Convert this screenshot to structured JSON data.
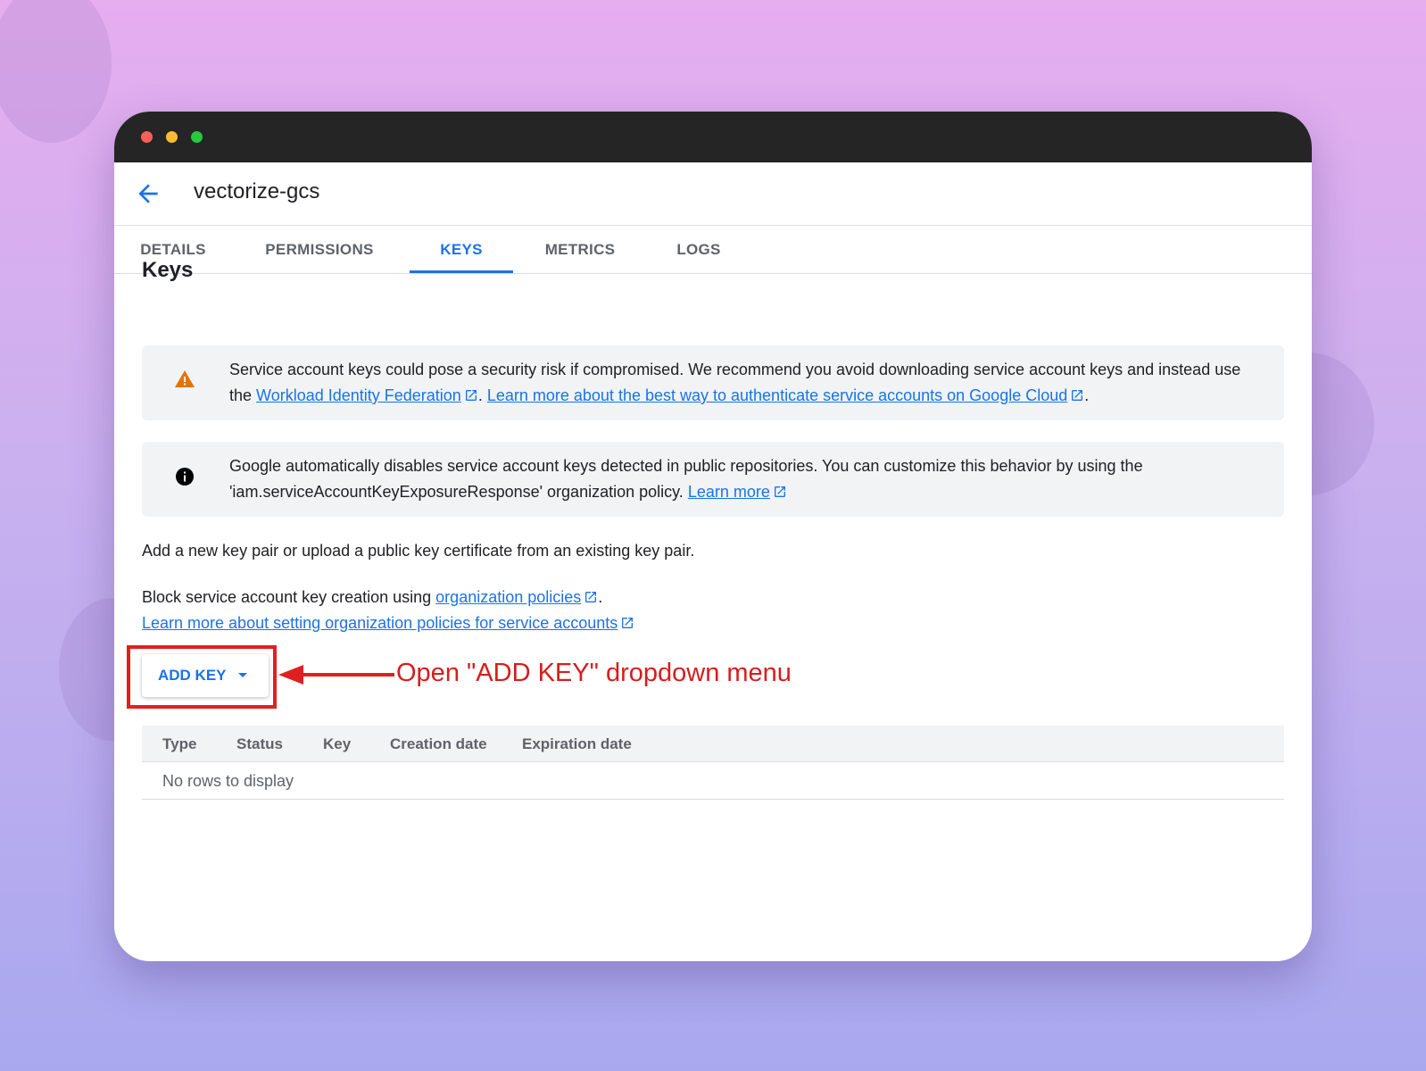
{
  "window": {
    "title": "vectorize-gcs",
    "controls": {
      "close_color": "#ff5f57",
      "minimize_color": "#febc2e",
      "maximize_color": "#28c840"
    }
  },
  "tabs": [
    {
      "label": "DETAILS",
      "active": false
    },
    {
      "label": "PERMISSIONS",
      "active": false
    },
    {
      "label": "KEYS",
      "active": true
    },
    {
      "label": "METRICS",
      "active": false
    },
    {
      "label": "LOGS",
      "active": false
    }
  ],
  "section_title": "Keys",
  "warning_banner": {
    "icon": "warning-icon",
    "text_1": "Service account keys could pose a security risk if compromised. We recommend you avoid downloading service account keys and instead use the ",
    "link_1": "Workload Identity Federation",
    "text_2": ". ",
    "link_2": "Learn more about the best way to authenticate service accounts on Google Cloud",
    "text_3": "."
  },
  "info_banner": {
    "icon": "info-icon",
    "text_1": "Google automatically disables service account keys detected in public repositories. You can customize this behavior by using the 'iam.serviceAccountKeyExposureResponse' organization policy. ",
    "link_1": "Learn more"
  },
  "add_key_description": "Add a new key pair or upload a public key certificate from an existing key pair.",
  "policy": {
    "text_1": "Block service account key creation using ",
    "link_1": "organization policies",
    "text_2": ".",
    "link_2": "Learn more about setting organization policies for service accounts"
  },
  "add_key_button": {
    "label": "ADD KEY"
  },
  "table": {
    "columns": [
      "Type",
      "Status",
      "Key",
      "Creation date",
      "Expiration date"
    ],
    "empty_message": "No rows to display"
  },
  "annotation": {
    "text": "Open \"ADD KEY\" dropdown menu",
    "color": "#d71d1d"
  },
  "colors": {
    "accent": "#1a73e8",
    "warning": "#e37400",
    "annotation_red": "#e02020"
  }
}
